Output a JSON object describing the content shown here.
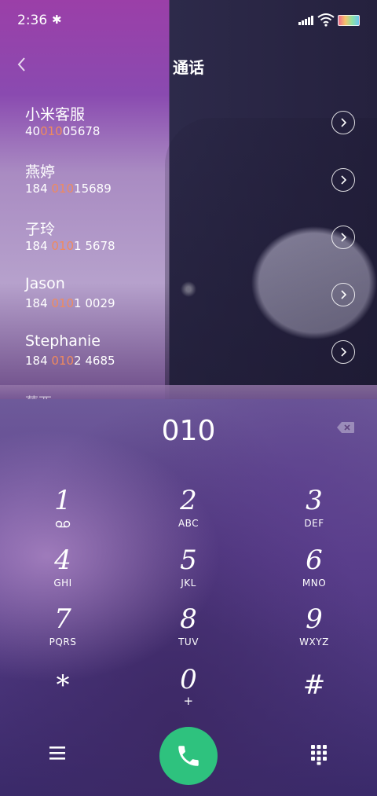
{
  "status_bar": {
    "time": "2:36",
    "bluetooth_glyph": "✱"
  },
  "header": {
    "title": "通话"
  },
  "contacts": [
    {
      "name": "小米客服",
      "number_pre": "40",
      "number_match": "010",
      "number_post": "05678"
    },
    {
      "name": "燕婷",
      "number_pre": "184 ",
      "number_match": "010",
      "number_post": "15689"
    },
    {
      "name": "子玲",
      "number_pre": "184 ",
      "number_match": "010",
      "number_post": "1 5678"
    },
    {
      "name": "Jason",
      "number_pre": "184 ",
      "number_match": "010",
      "number_post": "1 0029"
    },
    {
      "name": "Stephanie",
      "number_pre": "184 ",
      "number_match": "010",
      "number_post": "2 4685"
    }
  ],
  "partial_contact_name": "蔡西",
  "dial": {
    "value": "010"
  },
  "keypad": [
    {
      "digit": "1",
      "letters": "",
      "voicemail": true
    },
    {
      "digit": "2",
      "letters": "ABC"
    },
    {
      "digit": "3",
      "letters": "DEF"
    },
    {
      "digit": "4",
      "letters": "GHI"
    },
    {
      "digit": "5",
      "letters": "JKL"
    },
    {
      "digit": "6",
      "letters": "MNO"
    },
    {
      "digit": "7",
      "letters": "PQRS"
    },
    {
      "digit": "8",
      "letters": "TUV"
    },
    {
      "digit": "9",
      "letters": "WXYZ"
    },
    {
      "digit": "*",
      "letters": ""
    },
    {
      "digit": "0",
      "letters": "+"
    },
    {
      "digit": "#",
      "letters": ""
    }
  ],
  "colors": {
    "match_highlight": "#f08a5d",
    "call_green": "#2ec27e"
  },
  "icons": {
    "back": "back-icon",
    "chevron": "chevron-right-icon",
    "backspace": "backspace-icon",
    "menu": "menu-icon",
    "call": "phone-icon",
    "dialpad": "dialpad-icon"
  }
}
